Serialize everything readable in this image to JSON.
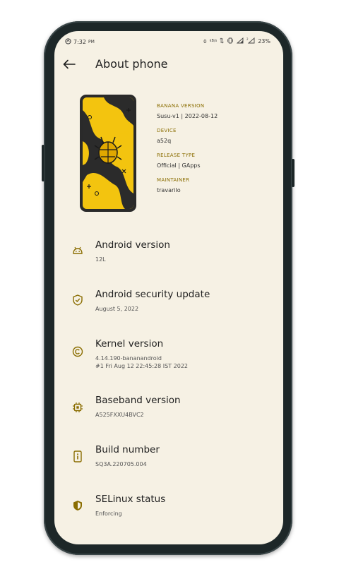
{
  "status_bar": {
    "time": "7:32",
    "time_suffix": "PM",
    "net_speed_value": "0",
    "net_speed_unit": "kB/s",
    "battery": "23%"
  },
  "app_bar": {
    "title": "About phone"
  },
  "device_info": [
    {
      "label": "BANANA VERSION",
      "value": "Susu-v1 | 2022-08-12"
    },
    {
      "label": "DEVICE",
      "value": "a52q"
    },
    {
      "label": "RELEASE TYPE",
      "value": "Official | GApps"
    },
    {
      "label": "MAINTAINER",
      "value": "travarilo"
    }
  ],
  "settings": [
    {
      "title": "Android version",
      "subtitle": "12L",
      "icon": "android-icon"
    },
    {
      "title": "Android security update",
      "subtitle": "August 5, 2022",
      "icon": "shield-check-icon"
    },
    {
      "title": "Kernel version",
      "subtitle": "4.14.190-bananandroid\n#1 Fri Aug 12 22:45:28 IST 2022",
      "icon": "copyright-icon"
    },
    {
      "title": "Baseband version",
      "subtitle": "A525FXXU4BVC2",
      "icon": "chip-icon"
    },
    {
      "title": "Build number",
      "subtitle": "SQ3A.220705.004",
      "icon": "info-box-icon"
    },
    {
      "title": "SELinux status",
      "subtitle": "Enforcing",
      "icon": "security-shield-icon"
    }
  ],
  "colors": {
    "background": "#f6f1e4",
    "accent": "#8a6d00",
    "banana_yellow": "#f3c40f",
    "frame": "#1d2728"
  }
}
